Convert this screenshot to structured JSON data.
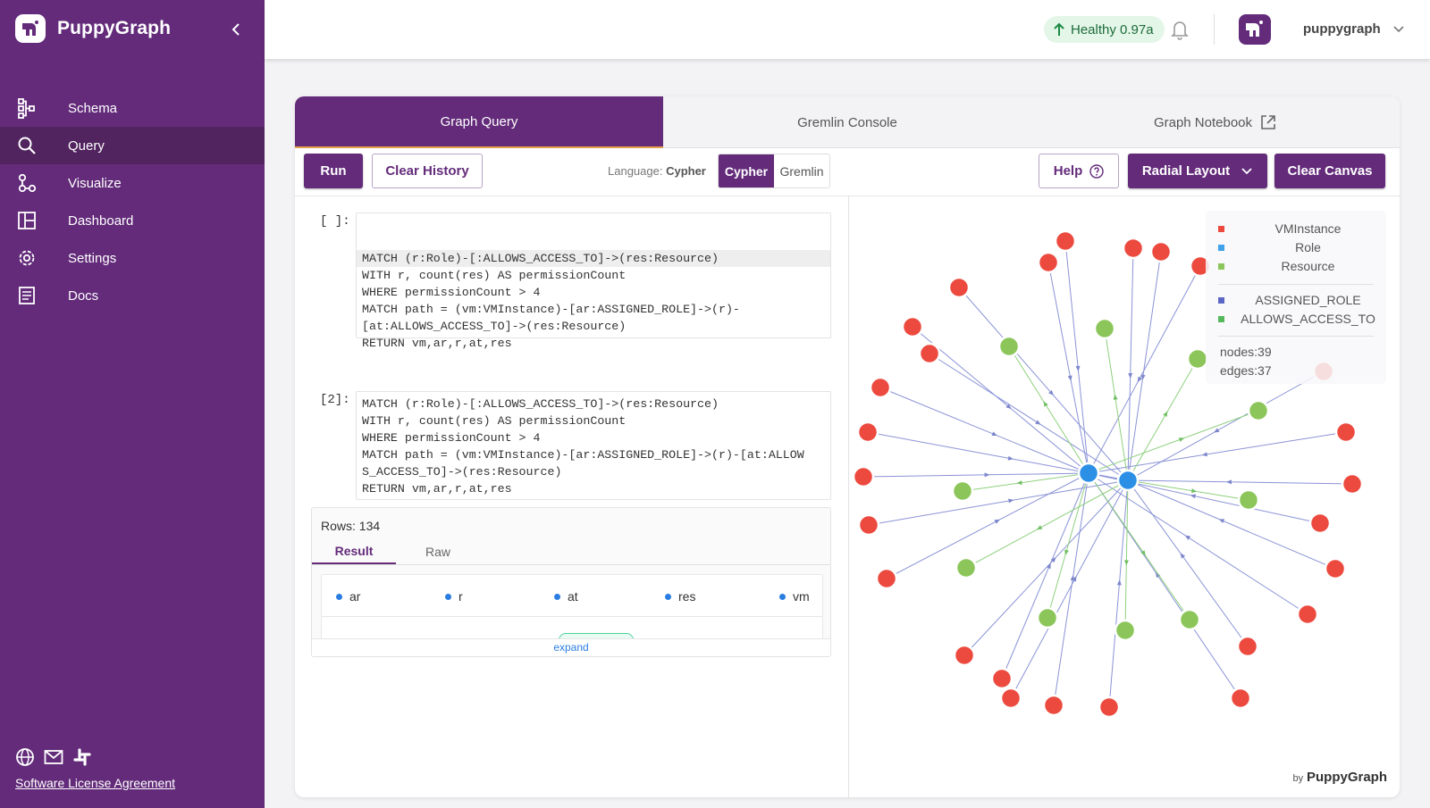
{
  "app": {
    "brand": "PuppyGraph"
  },
  "sidebar": {
    "items": [
      {
        "label": "Schema",
        "icon": "schema-icon",
        "active": false
      },
      {
        "label": "Query",
        "icon": "search-icon",
        "active": true
      },
      {
        "label": "Visualize",
        "icon": "visualize-icon",
        "active": false
      },
      {
        "label": "Dashboard",
        "icon": "dashboard-icon",
        "active": false
      },
      {
        "label": "Settings",
        "icon": "gear-icon",
        "active": false
      },
      {
        "label": "Docs",
        "icon": "docs-icon",
        "active": false
      }
    ],
    "footer_icons": [
      "globe-icon",
      "mail-icon",
      "slack-icon"
    ],
    "license_link": "Software License Agreement"
  },
  "topbar": {
    "health": "Healthy 0.97a",
    "username": "puppygraph"
  },
  "tabs": [
    {
      "label": "Graph Query",
      "active": true
    },
    {
      "label": "Gremlin Console",
      "active": false
    },
    {
      "label": "Graph Notebook",
      "active": false,
      "icon": "external-link-icon"
    }
  ],
  "toolbar": {
    "run": "Run",
    "clear_history": "Clear History",
    "language_prefix": "Language:",
    "language_value": "Cypher",
    "lang_options": [
      "Cypher",
      "Gremlin"
    ],
    "selected_language": "Cypher",
    "help": "Help",
    "layout": "Radial Layout",
    "clear_canvas": "Clear Canvas"
  },
  "cells": [
    {
      "label": "[ ]:",
      "lines": [
        "MATCH (r:Role)-[:ALLOWS_ACCESS_TO]->(res:Resource)",
        "WITH r, count(res) AS permissionCount",
        "WHERE permissionCount > 4",
        "MATCH path = (vm:VMInstance)-[ar:ASSIGNED_ROLE]->(r)-\n[at:ALLOWS_ACCESS_TO]->(res:Resource)",
        "RETURN vm,ar,r,at,res"
      ]
    },
    {
      "label": "[2]:",
      "lines": [
        "MATCH (r:Role)-[:ALLOWS_ACCESS_TO]->(res:Resource)",
        "WITH r, count(res) AS permissionCount",
        "WHERE permissionCount > 4",
        "MATCH path = (vm:VMInstance)-[ar:ASSIGNED_ROLE]->(r)-[at:ALLOW\nS_ACCESS_TO]->(res:Resource)",
        "RETURN vm,ar,r,at,res"
      ]
    }
  ],
  "result": {
    "rows_label": "Rows: 134",
    "tabs": [
      "Result",
      "Raw"
    ],
    "columns": [
      "ar",
      "r",
      "at",
      "res",
      "vm"
    ],
    "expand": "expand"
  },
  "legend": {
    "nodes": [
      {
        "label": "VMInstance",
        "color": "#ec4a3f"
      },
      {
        "label": "Role",
        "color": "#3fa2ea"
      },
      {
        "label": "Resource",
        "color": "#8cc65a"
      }
    ],
    "edges": [
      {
        "label": "ASSIGNED_ROLE",
        "color": "#5b67c7"
      },
      {
        "label": "ALLOWS_ACCESS_TO",
        "color": "#56b85d"
      }
    ],
    "stats": [
      "nodes:39",
      "edges:37"
    ]
  },
  "byline": {
    "prefix": "by",
    "name": "PuppyGraph"
  },
  "colors": {
    "brand": "#632b7a",
    "vm": "#ec4a3f",
    "role": "#2c8fe6",
    "resource": "#8cc65a",
    "edge_role": "#8a93d6",
    "edge_access": "#8fd07e"
  }
}
